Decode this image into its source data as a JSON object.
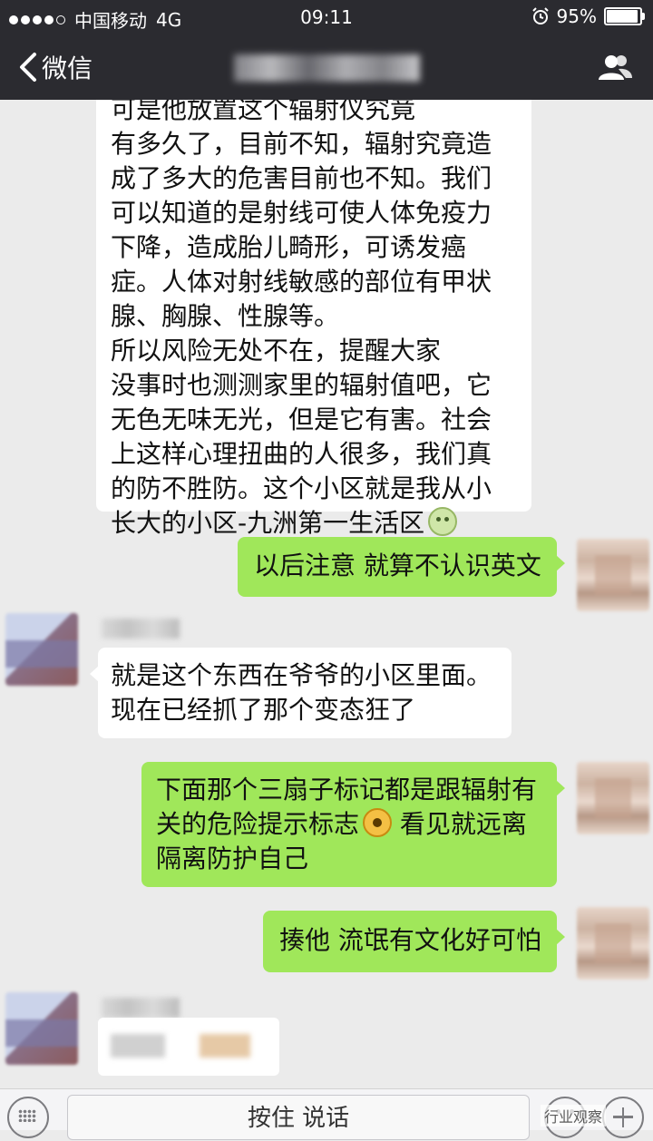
{
  "status_bar": {
    "carrier": "中国移动",
    "network": "4G",
    "time": "09:11",
    "battery_text": "95%",
    "battery_level": 0.95
  },
  "nav": {
    "back_label": "微信",
    "title_blurred": true
  },
  "messages": [
    {
      "side": "left",
      "lines": [
        "  可是他放置这个辐射仪究竟",
        "有多久了，目前不知，辐射究竟造",
        "成了多大的危害目前也不知。我们",
        "可以知道的是射线可使人体免疫力",
        "下降，造成胎儿畸形，可诱发癌",
        "症。人体对射线敏感的部位有甲状",
        "腺、胸腺、性腺等。",
        "      所以风险无处不在，提醒大家",
        "没事时也测测家里的辐射值吧，它",
        "无色无味无光，但是它有害。社会",
        "上这样心理扭曲的人很多，我们真",
        "的防不胜防。这个小区就是我从小",
        "长大的小区-九洲第一生活区"
      ],
      "trailing_emoji": "face"
    },
    {
      "side": "right",
      "lines": [
        "以后注意 就算不认识英文"
      ]
    },
    {
      "side": "left",
      "lines": [
        "就是这个东西在爷爷的小区里面。",
        "现在已经抓了那个变态狂了"
      ]
    },
    {
      "side": "right",
      "lines": [
        "下面那个三扇子标记都是跟辐射有",
        "关的危险提示标志",
        "隔离防护自己"
      ],
      "inline_emoji": "radioactive",
      "line2_suffix": " 看见就远离"
    },
    {
      "side": "right",
      "lines": [
        "揍他 流氓有文化好可怕"
      ]
    }
  ],
  "input_bar": {
    "talk_label": "按住 说话",
    "keyboard_icon": "keyboard-icon",
    "emoji_icon": "emoji-icon",
    "plus_icon": "plus-icon"
  },
  "watermark": "行业观察"
}
